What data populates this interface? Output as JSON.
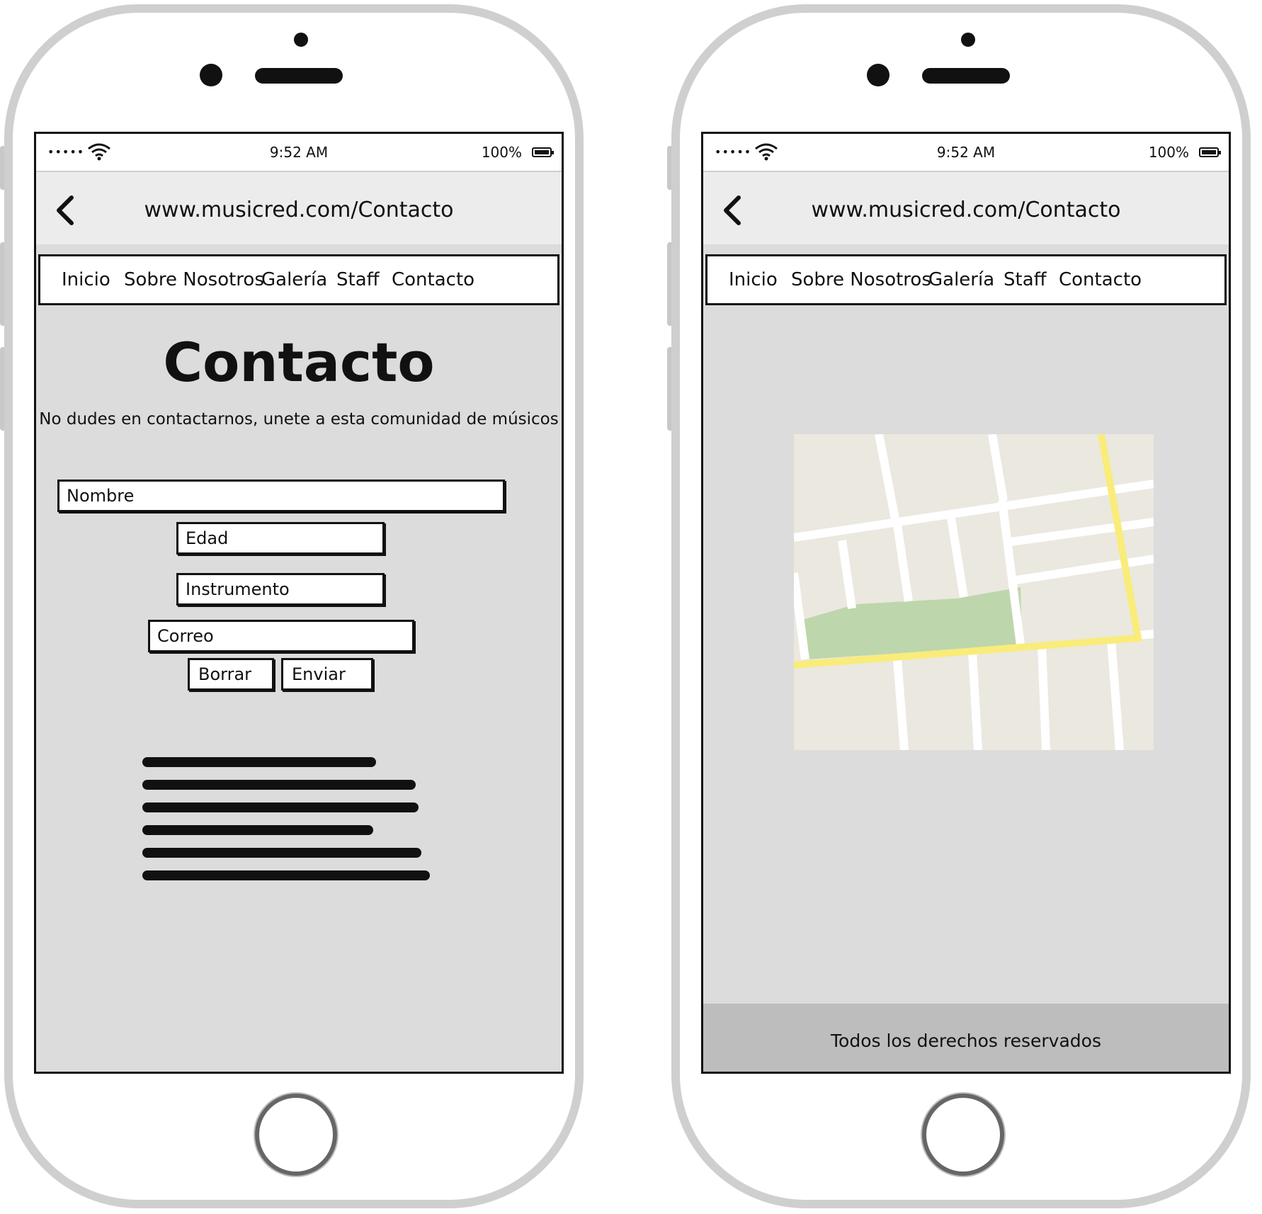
{
  "status_bar": {
    "signal": "•••••",
    "time": "9:52 AM",
    "battery": "100%"
  },
  "browser": {
    "url": "www.musicred.com/Contacto"
  },
  "nav": {
    "items": [
      "Inicio",
      "Sobre Nosotros",
      "Galería",
      "Staff",
      "Contacto"
    ]
  },
  "contact": {
    "title": "Contacto",
    "subtitle": "No dudes en contactarnos, unete a esta comunidad de músicos",
    "fields": {
      "nombre": "Nombre",
      "edad": "Edad",
      "instrumento": "Instrumento",
      "correo": "Correo"
    },
    "buttons": {
      "borrar": "Borrar",
      "enviar": "Enviar"
    }
  },
  "footer": {
    "text": "Todos los derechos reservados"
  },
  "colors": {
    "screen_bg": "#dcdcdc",
    "map_land": "#ebe8e0",
    "map_road": "#ffffff",
    "map_park": "#bed6ab",
    "map_highway": "#f9ec7a",
    "footer_bg": "#bdbdbd"
  }
}
